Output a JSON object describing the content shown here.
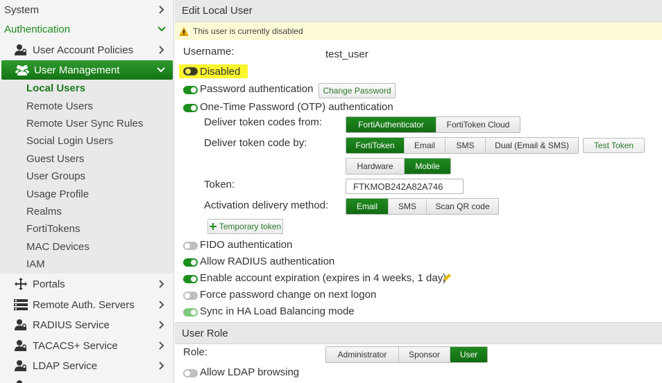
{
  "sidebar": {
    "system": "System",
    "authentication": "Authentication",
    "user_account_policies": "User Account Policies",
    "user_management": "User Management",
    "sub_items": [
      "Local Users",
      "Remote Users",
      "Remote User Sync Rules",
      "Social Login Users",
      "Guest Users",
      "User Groups",
      "Usage Profile",
      "Realms",
      "FortiTokens",
      "MAC Devices",
      "IAM"
    ],
    "portals": "Portals",
    "remote_auth_servers": "Remote Auth. Servers",
    "radius_service": "RADIUS Service",
    "tacacs_service": "TACACS+ Service",
    "ldap_service": "LDAP Service"
  },
  "form": {
    "title": "Edit Local User",
    "warning": "This user is currently disabled",
    "username_label": "Username:",
    "username_value": "test_user",
    "disabled_label": "Disabled",
    "password_auth_label": "Password authentication",
    "change_password_button": "Change Password",
    "otp_label": "One-Time Password (OTP) authentication",
    "deliver_from_label": "Deliver token codes from:",
    "deliver_from_options": [
      "FortiAuthenticator",
      "FortiToken Cloud"
    ],
    "deliver_by_label": "Deliver token code by:",
    "deliver_by_options": [
      "FortiToken",
      "Email",
      "SMS",
      "Dual (Email & SMS)"
    ],
    "test_token_button": "Test Token",
    "token_type_options": [
      "Hardware",
      "Mobile"
    ],
    "token_label": "Token:",
    "token_value": "FTKMOB242A82A746",
    "activation_label": "Activation delivery method:",
    "activation_options": [
      "Email",
      "SMS",
      "Scan QR code"
    ],
    "temporary_token_button": "Temporary token",
    "fido_label": "FIDO authentication",
    "radius_label": "Allow RADIUS authentication",
    "expiration_label": "Enable account expiration (expires in 4 weeks, 1 day)",
    "force_pw_label": "Force password change on next logon",
    "sync_ha_label": "Sync in HA Load Balancing mode"
  },
  "role": {
    "title": "User Role",
    "role_label": "Role:",
    "role_options": [
      "Administrator",
      "Sponsor",
      "User"
    ],
    "ldap_browse_label": "Allow LDAP browsing"
  },
  "colors": {
    "accent": "#1c8f1c",
    "highlight": "#fbf62d",
    "warning_bg": "#fdfbd6"
  }
}
